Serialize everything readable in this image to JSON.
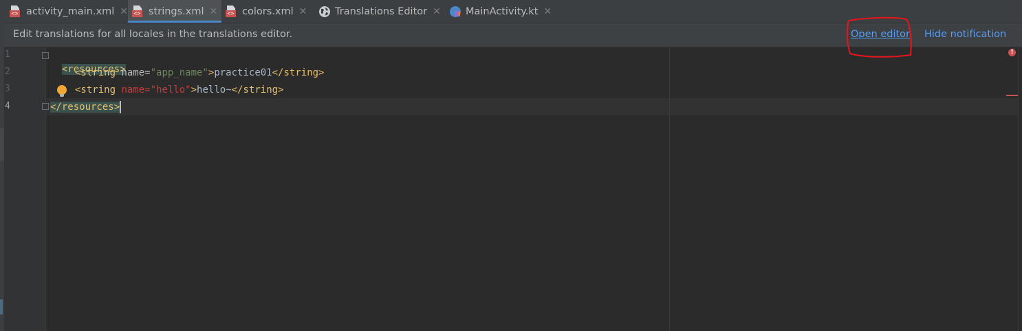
{
  "tabs": [
    {
      "label": "activity_main.xml",
      "icon": "xml-file-icon",
      "active": false
    },
    {
      "label": "strings.xml",
      "icon": "xml-file-icon",
      "active": true
    },
    {
      "label": "colors.xml",
      "icon": "xml-file-icon",
      "active": false
    },
    {
      "label": "Translations Editor",
      "icon": "globe-icon",
      "active": false
    },
    {
      "label": "MainActivity.kt",
      "icon": "kotlin-file-icon",
      "active": false
    }
  ],
  "notification": {
    "message": "Edit translations for all locales in the translations editor.",
    "open_editor": "Open editor",
    "hide": "Hide notification"
  },
  "editor": {
    "line_numbers": [
      "1",
      "2",
      "3",
      "4"
    ],
    "lines": {
      "l1_tag": "<resources>",
      "l2_open": "<string ",
      "l2_attr": "name=",
      "l2_val": "\"app_name\"",
      "l2_close": ">",
      "l2_text": "practice01",
      "l2_end": "</string>",
      "l3_open": "<string ",
      "l3_attr": "name=",
      "l3_val": "\"hello\"",
      "l3_close": ">",
      "l3_text": "hello~",
      "l3_end": "</string>",
      "l4_tag": "</resources>"
    }
  },
  "colors": {
    "accent": "#589df6",
    "tag": "#e8bf6a",
    "string_value": "#6a8759",
    "error": "#c75450",
    "annotation": "#e8141b"
  }
}
